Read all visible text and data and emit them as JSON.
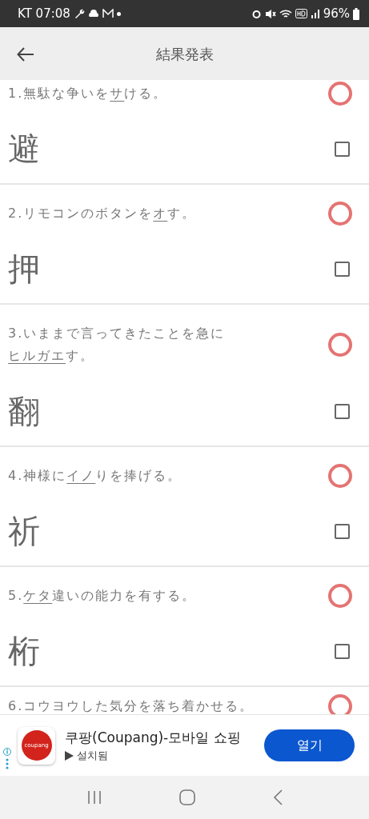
{
  "status_bar": {
    "carrier_time": "KT 07:08",
    "battery": "96%"
  },
  "app_bar": {
    "title": "結果発表"
  },
  "questions": [
    {
      "number": "1.",
      "before": "無駄な争いを",
      "underlined": "サ",
      "after": "ける。",
      "answer": "避",
      "correct": true,
      "checked": false
    },
    {
      "number": "2.",
      "before": "リモコンのボタンを",
      "underlined": "オ",
      "after": "す。",
      "answer": "押",
      "correct": true,
      "checked": false
    },
    {
      "number": "3.",
      "before": "いままで言ってきたことを急に",
      "underlined": "ヒルガエ",
      "after": "す。",
      "answer": "翻",
      "correct": true,
      "checked": false
    },
    {
      "number": "4.",
      "before": "神様に",
      "underlined": "イノ",
      "after": "りを捧げる。",
      "answer": "祈",
      "correct": true,
      "checked": false
    },
    {
      "number": "5.",
      "underlined": "ケタ",
      "after": "違いの能力を有する。",
      "answer": "桁",
      "correct": true,
      "checked": false
    },
    {
      "number": "6.",
      "before": "コウヨウした気分を落ち着かせる。",
      "correct": true
    }
  ],
  "ad": {
    "logo_text": "coupang",
    "app_name": "쿠팡(Coupang)-모바일 쇼핑",
    "status": "설치됨",
    "button": "열기"
  }
}
